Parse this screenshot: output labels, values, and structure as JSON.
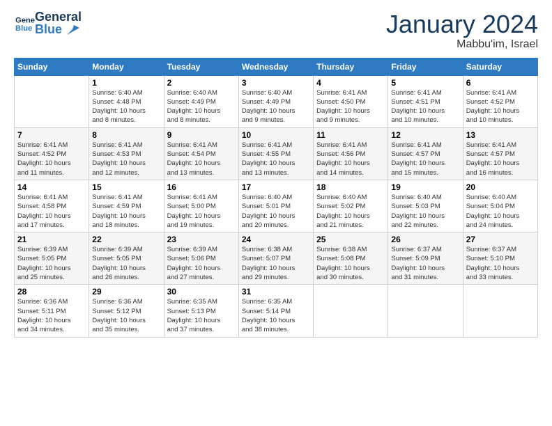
{
  "header": {
    "logo_general": "General",
    "logo_blue": "Blue",
    "month_title": "January 2024",
    "location": "Mabbu'im, Israel"
  },
  "columns": [
    "Sunday",
    "Monday",
    "Tuesday",
    "Wednesday",
    "Thursday",
    "Friday",
    "Saturday"
  ],
  "weeks": [
    [
      {
        "day": "",
        "info": ""
      },
      {
        "day": "1",
        "info": "Sunrise: 6:40 AM\nSunset: 4:48 PM\nDaylight: 10 hours\nand 8 minutes."
      },
      {
        "day": "2",
        "info": "Sunrise: 6:40 AM\nSunset: 4:49 PM\nDaylight: 10 hours\nand 8 minutes."
      },
      {
        "day": "3",
        "info": "Sunrise: 6:40 AM\nSunset: 4:49 PM\nDaylight: 10 hours\nand 9 minutes."
      },
      {
        "day": "4",
        "info": "Sunrise: 6:41 AM\nSunset: 4:50 PM\nDaylight: 10 hours\nand 9 minutes."
      },
      {
        "day": "5",
        "info": "Sunrise: 6:41 AM\nSunset: 4:51 PM\nDaylight: 10 hours\nand 10 minutes."
      },
      {
        "day": "6",
        "info": "Sunrise: 6:41 AM\nSunset: 4:52 PM\nDaylight: 10 hours\nand 10 minutes."
      }
    ],
    [
      {
        "day": "7",
        "info": "Sunrise: 6:41 AM\nSunset: 4:52 PM\nDaylight: 10 hours\nand 11 minutes."
      },
      {
        "day": "8",
        "info": "Sunrise: 6:41 AM\nSunset: 4:53 PM\nDaylight: 10 hours\nand 12 minutes."
      },
      {
        "day": "9",
        "info": "Sunrise: 6:41 AM\nSunset: 4:54 PM\nDaylight: 10 hours\nand 13 minutes."
      },
      {
        "day": "10",
        "info": "Sunrise: 6:41 AM\nSunset: 4:55 PM\nDaylight: 10 hours\nand 13 minutes."
      },
      {
        "day": "11",
        "info": "Sunrise: 6:41 AM\nSunset: 4:56 PM\nDaylight: 10 hours\nand 14 minutes."
      },
      {
        "day": "12",
        "info": "Sunrise: 6:41 AM\nSunset: 4:57 PM\nDaylight: 10 hours\nand 15 minutes."
      },
      {
        "day": "13",
        "info": "Sunrise: 6:41 AM\nSunset: 4:57 PM\nDaylight: 10 hours\nand 16 minutes."
      }
    ],
    [
      {
        "day": "14",
        "info": "Sunrise: 6:41 AM\nSunset: 4:58 PM\nDaylight: 10 hours\nand 17 minutes."
      },
      {
        "day": "15",
        "info": "Sunrise: 6:41 AM\nSunset: 4:59 PM\nDaylight: 10 hours\nand 18 minutes."
      },
      {
        "day": "16",
        "info": "Sunrise: 6:41 AM\nSunset: 5:00 PM\nDaylight: 10 hours\nand 19 minutes."
      },
      {
        "day": "17",
        "info": "Sunrise: 6:40 AM\nSunset: 5:01 PM\nDaylight: 10 hours\nand 20 minutes."
      },
      {
        "day": "18",
        "info": "Sunrise: 6:40 AM\nSunset: 5:02 PM\nDaylight: 10 hours\nand 21 minutes."
      },
      {
        "day": "19",
        "info": "Sunrise: 6:40 AM\nSunset: 5:03 PM\nDaylight: 10 hours\nand 22 minutes."
      },
      {
        "day": "20",
        "info": "Sunrise: 6:40 AM\nSunset: 5:04 PM\nDaylight: 10 hours\nand 24 minutes."
      }
    ],
    [
      {
        "day": "21",
        "info": "Sunrise: 6:39 AM\nSunset: 5:05 PM\nDaylight: 10 hours\nand 25 minutes."
      },
      {
        "day": "22",
        "info": "Sunrise: 6:39 AM\nSunset: 5:05 PM\nDaylight: 10 hours\nand 26 minutes."
      },
      {
        "day": "23",
        "info": "Sunrise: 6:39 AM\nSunset: 5:06 PM\nDaylight: 10 hours\nand 27 minutes."
      },
      {
        "day": "24",
        "info": "Sunrise: 6:38 AM\nSunset: 5:07 PM\nDaylight: 10 hours\nand 29 minutes."
      },
      {
        "day": "25",
        "info": "Sunrise: 6:38 AM\nSunset: 5:08 PM\nDaylight: 10 hours\nand 30 minutes."
      },
      {
        "day": "26",
        "info": "Sunrise: 6:37 AM\nSunset: 5:09 PM\nDaylight: 10 hours\nand 31 minutes."
      },
      {
        "day": "27",
        "info": "Sunrise: 6:37 AM\nSunset: 5:10 PM\nDaylight: 10 hours\nand 33 minutes."
      }
    ],
    [
      {
        "day": "28",
        "info": "Sunrise: 6:36 AM\nSunset: 5:11 PM\nDaylight: 10 hours\nand 34 minutes."
      },
      {
        "day": "29",
        "info": "Sunrise: 6:36 AM\nSunset: 5:12 PM\nDaylight: 10 hours\nand 35 minutes."
      },
      {
        "day": "30",
        "info": "Sunrise: 6:35 AM\nSunset: 5:13 PM\nDaylight: 10 hours\nand 37 minutes."
      },
      {
        "day": "31",
        "info": "Sunrise: 6:35 AM\nSunset: 5:14 PM\nDaylight: 10 hours\nand 38 minutes."
      },
      {
        "day": "",
        "info": ""
      },
      {
        "day": "",
        "info": ""
      },
      {
        "day": "",
        "info": ""
      }
    ]
  ]
}
